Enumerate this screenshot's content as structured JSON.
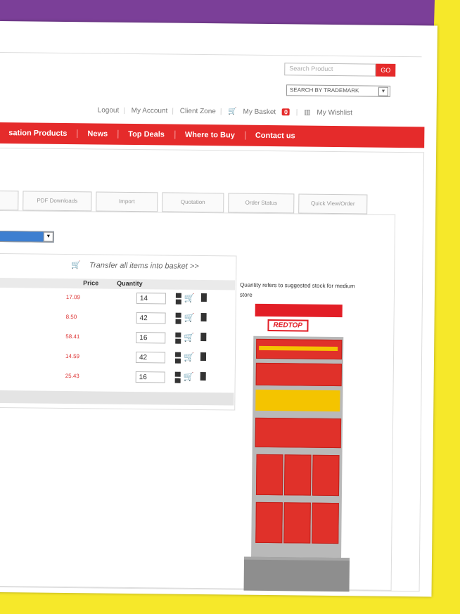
{
  "header": {
    "search_placeholder": "Search Product",
    "go_label": "GO",
    "trademark_select": "SEARCH BY TRADEMARK",
    "account_links": {
      "logout": "Logout",
      "my_account": "My Account",
      "client_zone": "Client Zone",
      "my_basket": "My Basket",
      "basket_count": "0",
      "my_wishlist": "My Wishlist"
    }
  },
  "nav": {
    "items": [
      "sation Products",
      "News",
      "Top Deals",
      "Where to Buy",
      "Contact us"
    ]
  },
  "tabs": [
    "PDF Downloads",
    "Import",
    "Quotation",
    "Order Status",
    "Quick View/Order"
  ],
  "basket_panel": {
    "transfer_label": "Transfer all items into basket >>",
    "columns": {
      "price": "Price",
      "quantity": "Quantity"
    },
    "rows": [
      {
        "price": "17.09",
        "quantity": "14"
      },
      {
        "price": "8.50",
        "quantity": "42"
      },
      {
        "price": "58.41",
        "quantity": "16"
      },
      {
        "price": "14.59",
        "quantity": "42"
      },
      {
        "price": "25.43",
        "quantity": "16"
      }
    ]
  },
  "note": "Quantity refers to suggested stock for medium store",
  "display_logo": "REDTOP",
  "colors": {
    "brand_red": "#e52b2b",
    "purple_bg": "#7b3f98",
    "yellow_bg": "#f6e82a"
  }
}
